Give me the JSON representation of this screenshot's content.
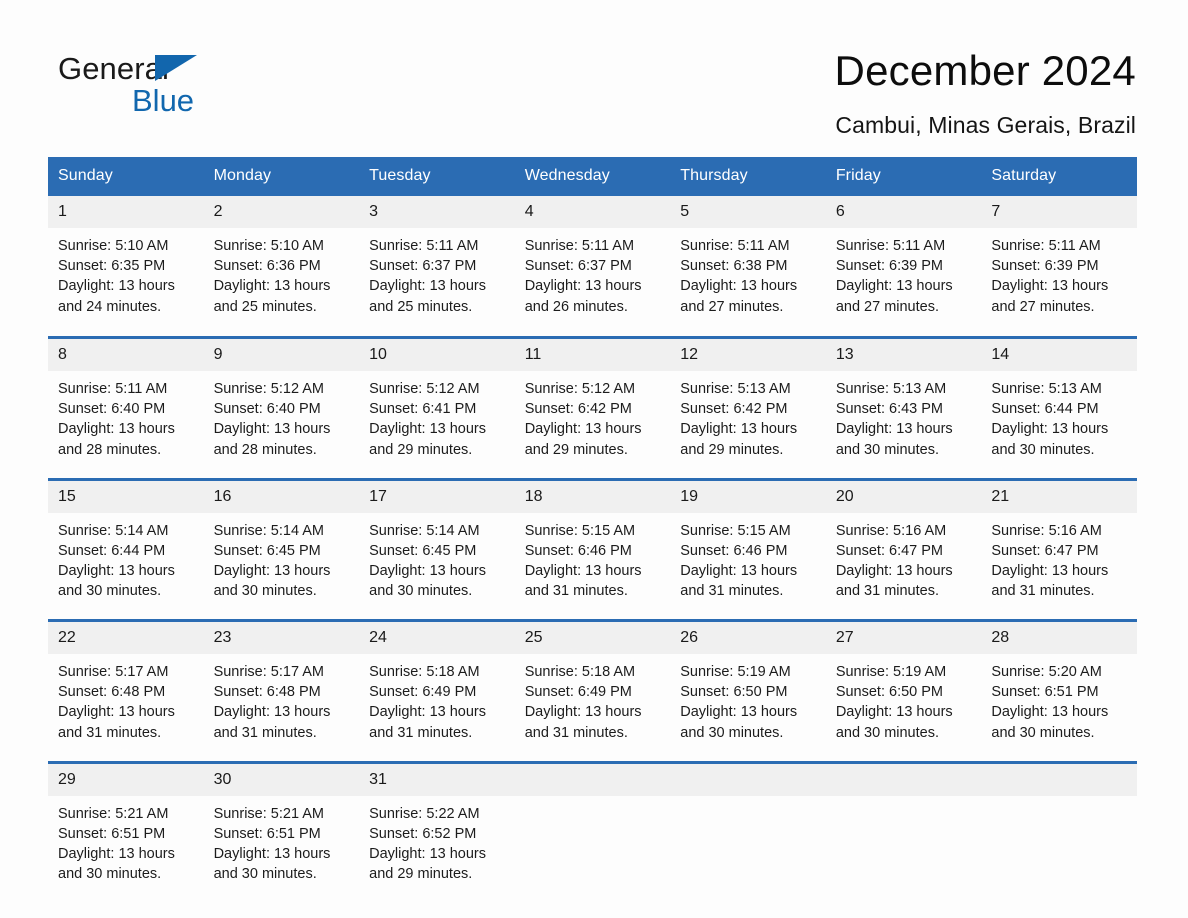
{
  "brand": {
    "name_part1": "General",
    "name_part2": "Blue",
    "logo_icon": "triangle-logo-icon"
  },
  "header": {
    "title": "December 2024",
    "location": "Cambui, Minas Gerais, Brazil"
  },
  "colors": {
    "header_blue": "#2b6cb3",
    "brand_blue": "#1167ae",
    "daynum_background": "#f0f0f0",
    "page_background": "#fdfdfd",
    "text": "#1a1a1a"
  },
  "weekday_headers": [
    "Sunday",
    "Monday",
    "Tuesday",
    "Wednesday",
    "Thursday",
    "Friday",
    "Saturday"
  ],
  "weeks": [
    [
      {
        "day": "1",
        "sunrise": "Sunrise: 5:10 AM",
        "sunset": "Sunset: 6:35 PM",
        "daylight_line1": "Daylight: 13 hours",
        "daylight_line2": "and 24 minutes."
      },
      {
        "day": "2",
        "sunrise": "Sunrise: 5:10 AM",
        "sunset": "Sunset: 6:36 PM",
        "daylight_line1": "Daylight: 13 hours",
        "daylight_line2": "and 25 minutes."
      },
      {
        "day": "3",
        "sunrise": "Sunrise: 5:11 AM",
        "sunset": "Sunset: 6:37 PM",
        "daylight_line1": "Daylight: 13 hours",
        "daylight_line2": "and 25 minutes."
      },
      {
        "day": "4",
        "sunrise": "Sunrise: 5:11 AM",
        "sunset": "Sunset: 6:37 PM",
        "daylight_line1": "Daylight: 13 hours",
        "daylight_line2": "and 26 minutes."
      },
      {
        "day": "5",
        "sunrise": "Sunrise: 5:11 AM",
        "sunset": "Sunset: 6:38 PM",
        "daylight_line1": "Daylight: 13 hours",
        "daylight_line2": "and 27 minutes."
      },
      {
        "day": "6",
        "sunrise": "Sunrise: 5:11 AM",
        "sunset": "Sunset: 6:39 PM",
        "daylight_line1": "Daylight: 13 hours",
        "daylight_line2": "and 27 minutes."
      },
      {
        "day": "7",
        "sunrise": "Sunrise: 5:11 AM",
        "sunset": "Sunset: 6:39 PM",
        "daylight_line1": "Daylight: 13 hours",
        "daylight_line2": "and 27 minutes."
      }
    ],
    [
      {
        "day": "8",
        "sunrise": "Sunrise: 5:11 AM",
        "sunset": "Sunset: 6:40 PM",
        "daylight_line1": "Daylight: 13 hours",
        "daylight_line2": "and 28 minutes."
      },
      {
        "day": "9",
        "sunrise": "Sunrise: 5:12 AM",
        "sunset": "Sunset: 6:40 PM",
        "daylight_line1": "Daylight: 13 hours",
        "daylight_line2": "and 28 minutes."
      },
      {
        "day": "10",
        "sunrise": "Sunrise: 5:12 AM",
        "sunset": "Sunset: 6:41 PM",
        "daylight_line1": "Daylight: 13 hours",
        "daylight_line2": "and 29 minutes."
      },
      {
        "day": "11",
        "sunrise": "Sunrise: 5:12 AM",
        "sunset": "Sunset: 6:42 PM",
        "daylight_line1": "Daylight: 13 hours",
        "daylight_line2": "and 29 minutes."
      },
      {
        "day": "12",
        "sunrise": "Sunrise: 5:13 AM",
        "sunset": "Sunset: 6:42 PM",
        "daylight_line1": "Daylight: 13 hours",
        "daylight_line2": "and 29 minutes."
      },
      {
        "day": "13",
        "sunrise": "Sunrise: 5:13 AM",
        "sunset": "Sunset: 6:43 PM",
        "daylight_line1": "Daylight: 13 hours",
        "daylight_line2": "and 30 minutes."
      },
      {
        "day": "14",
        "sunrise": "Sunrise: 5:13 AM",
        "sunset": "Sunset: 6:44 PM",
        "daylight_line1": "Daylight: 13 hours",
        "daylight_line2": "and 30 minutes."
      }
    ],
    [
      {
        "day": "15",
        "sunrise": "Sunrise: 5:14 AM",
        "sunset": "Sunset: 6:44 PM",
        "daylight_line1": "Daylight: 13 hours",
        "daylight_line2": "and 30 minutes."
      },
      {
        "day": "16",
        "sunrise": "Sunrise: 5:14 AM",
        "sunset": "Sunset: 6:45 PM",
        "daylight_line1": "Daylight: 13 hours",
        "daylight_line2": "and 30 minutes."
      },
      {
        "day": "17",
        "sunrise": "Sunrise: 5:14 AM",
        "sunset": "Sunset: 6:45 PM",
        "daylight_line1": "Daylight: 13 hours",
        "daylight_line2": "and 30 minutes."
      },
      {
        "day": "18",
        "sunrise": "Sunrise: 5:15 AM",
        "sunset": "Sunset: 6:46 PM",
        "daylight_line1": "Daylight: 13 hours",
        "daylight_line2": "and 31 minutes."
      },
      {
        "day": "19",
        "sunrise": "Sunrise: 5:15 AM",
        "sunset": "Sunset: 6:46 PM",
        "daylight_line1": "Daylight: 13 hours",
        "daylight_line2": "and 31 minutes."
      },
      {
        "day": "20",
        "sunrise": "Sunrise: 5:16 AM",
        "sunset": "Sunset: 6:47 PM",
        "daylight_line1": "Daylight: 13 hours",
        "daylight_line2": "and 31 minutes."
      },
      {
        "day": "21",
        "sunrise": "Sunrise: 5:16 AM",
        "sunset": "Sunset: 6:47 PM",
        "daylight_line1": "Daylight: 13 hours",
        "daylight_line2": "and 31 minutes."
      }
    ],
    [
      {
        "day": "22",
        "sunrise": "Sunrise: 5:17 AM",
        "sunset": "Sunset: 6:48 PM",
        "daylight_line1": "Daylight: 13 hours",
        "daylight_line2": "and 31 minutes."
      },
      {
        "day": "23",
        "sunrise": "Sunrise: 5:17 AM",
        "sunset": "Sunset: 6:48 PM",
        "daylight_line1": "Daylight: 13 hours",
        "daylight_line2": "and 31 minutes."
      },
      {
        "day": "24",
        "sunrise": "Sunrise: 5:18 AM",
        "sunset": "Sunset: 6:49 PM",
        "daylight_line1": "Daylight: 13 hours",
        "daylight_line2": "and 31 minutes."
      },
      {
        "day": "25",
        "sunrise": "Sunrise: 5:18 AM",
        "sunset": "Sunset: 6:49 PM",
        "daylight_line1": "Daylight: 13 hours",
        "daylight_line2": "and 31 minutes."
      },
      {
        "day": "26",
        "sunrise": "Sunrise: 5:19 AM",
        "sunset": "Sunset: 6:50 PM",
        "daylight_line1": "Daylight: 13 hours",
        "daylight_line2": "and 30 minutes."
      },
      {
        "day": "27",
        "sunrise": "Sunrise: 5:19 AM",
        "sunset": "Sunset: 6:50 PM",
        "daylight_line1": "Daylight: 13 hours",
        "daylight_line2": "and 30 minutes."
      },
      {
        "day": "28",
        "sunrise": "Sunrise: 5:20 AM",
        "sunset": "Sunset: 6:51 PM",
        "daylight_line1": "Daylight: 13 hours",
        "daylight_line2": "and 30 minutes."
      }
    ],
    [
      {
        "day": "29",
        "sunrise": "Sunrise: 5:21 AM",
        "sunset": "Sunset: 6:51 PM",
        "daylight_line1": "Daylight: 13 hours",
        "daylight_line2": "and 30 minutes."
      },
      {
        "day": "30",
        "sunrise": "Sunrise: 5:21 AM",
        "sunset": "Sunset: 6:51 PM",
        "daylight_line1": "Daylight: 13 hours",
        "daylight_line2": "and 30 minutes."
      },
      {
        "day": "31",
        "sunrise": "Sunrise: 5:22 AM",
        "sunset": "Sunset: 6:52 PM",
        "daylight_line1": "Daylight: 13 hours",
        "daylight_line2": "and 29 minutes."
      },
      {
        "day": "",
        "sunrise": "",
        "sunset": "",
        "daylight_line1": "",
        "daylight_line2": ""
      },
      {
        "day": "",
        "sunrise": "",
        "sunset": "",
        "daylight_line1": "",
        "daylight_line2": ""
      },
      {
        "day": "",
        "sunrise": "",
        "sunset": "",
        "daylight_line1": "",
        "daylight_line2": ""
      },
      {
        "day": "",
        "sunrise": "",
        "sunset": "",
        "daylight_line1": "",
        "daylight_line2": ""
      }
    ]
  ]
}
